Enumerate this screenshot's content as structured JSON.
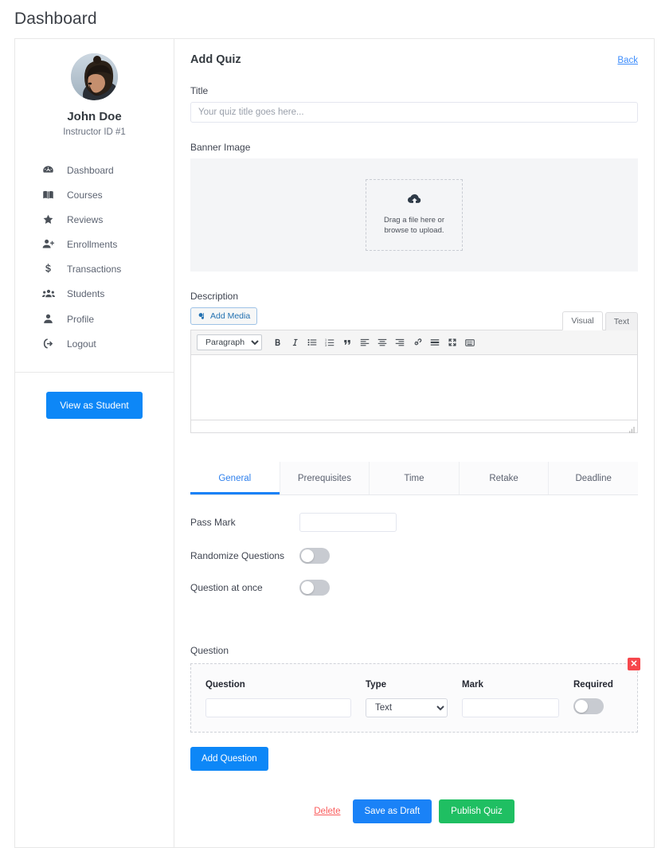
{
  "page": {
    "title": "Dashboard"
  },
  "sidebar": {
    "user_name": "John Doe",
    "user_sub": "Instructor ID #1",
    "avatar_name": "avatar",
    "items": [
      {
        "label": "Dashboard",
        "icon": "dashboard-icon"
      },
      {
        "label": "Courses",
        "icon": "book-icon"
      },
      {
        "label": "Reviews",
        "icon": "star-icon"
      },
      {
        "label": "Enrollments",
        "icon": "user-plus-icon"
      },
      {
        "label": "Transactions",
        "icon": "dollar-icon"
      },
      {
        "label": "Students",
        "icon": "users-icon"
      },
      {
        "label": "Profile",
        "icon": "user-icon"
      },
      {
        "label": "Logout",
        "icon": "logout-icon"
      }
    ],
    "view_as_student": "View as Student"
  },
  "main": {
    "heading": "Add Quiz",
    "back_label": "Back",
    "title_field": {
      "label": "Title",
      "placeholder": "Your quiz title goes here...",
      "value": ""
    },
    "banner": {
      "label": "Banner Image",
      "dropzone_text": "Drag a file here or browse to upload.",
      "icon": "cloud-upload-icon"
    },
    "description": {
      "label": "Description",
      "add_media_label": "Add Media",
      "modes": [
        {
          "label": "Visual",
          "active": true
        },
        {
          "label": "Text",
          "active": false
        }
      ],
      "format_select": "Paragraph",
      "toolbar_icons": [
        "bold-icon",
        "italic-icon",
        "bulleted-list-icon",
        "numbered-list-icon",
        "blockquote-icon",
        "align-left-icon",
        "align-center-icon",
        "align-right-icon",
        "link-icon",
        "read-more-icon",
        "fullscreen-icon",
        "toolbar-toggle-icon"
      ],
      "body_value": ""
    },
    "tabs": [
      {
        "label": "General",
        "active": true
      },
      {
        "label": "Prerequisites",
        "active": false
      },
      {
        "label": "Time",
        "active": false
      },
      {
        "label": "Retake",
        "active": false
      },
      {
        "label": "Deadline",
        "active": false
      }
    ],
    "general": {
      "pass_mark": {
        "label": "Pass Mark",
        "value": ""
      },
      "randomize": {
        "label": "Randomize Questions",
        "on": false
      },
      "question_at_once": {
        "label": "Question at once",
        "on": false
      }
    },
    "question_section": {
      "label": "Question",
      "remove_icon": "close-icon",
      "columns": {
        "question": "Question",
        "type": "Type",
        "mark": "Mark",
        "required": "Required"
      },
      "row": {
        "question_value": "",
        "type_value": "Text",
        "type_options": [
          "Text"
        ],
        "mark_value": "",
        "required_on": false
      },
      "add_question_label": "Add Question"
    },
    "footer": {
      "delete_label": "Delete",
      "save_draft_label": "Save as Draft",
      "publish_label": "Publish Quiz"
    }
  },
  "colors": {
    "primary_blue": "#0d87f7",
    "publish_green": "#1fbf62",
    "delete_red": "#fa5c5c",
    "close_red": "#f6474c",
    "tab_active": "#2f80ed"
  }
}
